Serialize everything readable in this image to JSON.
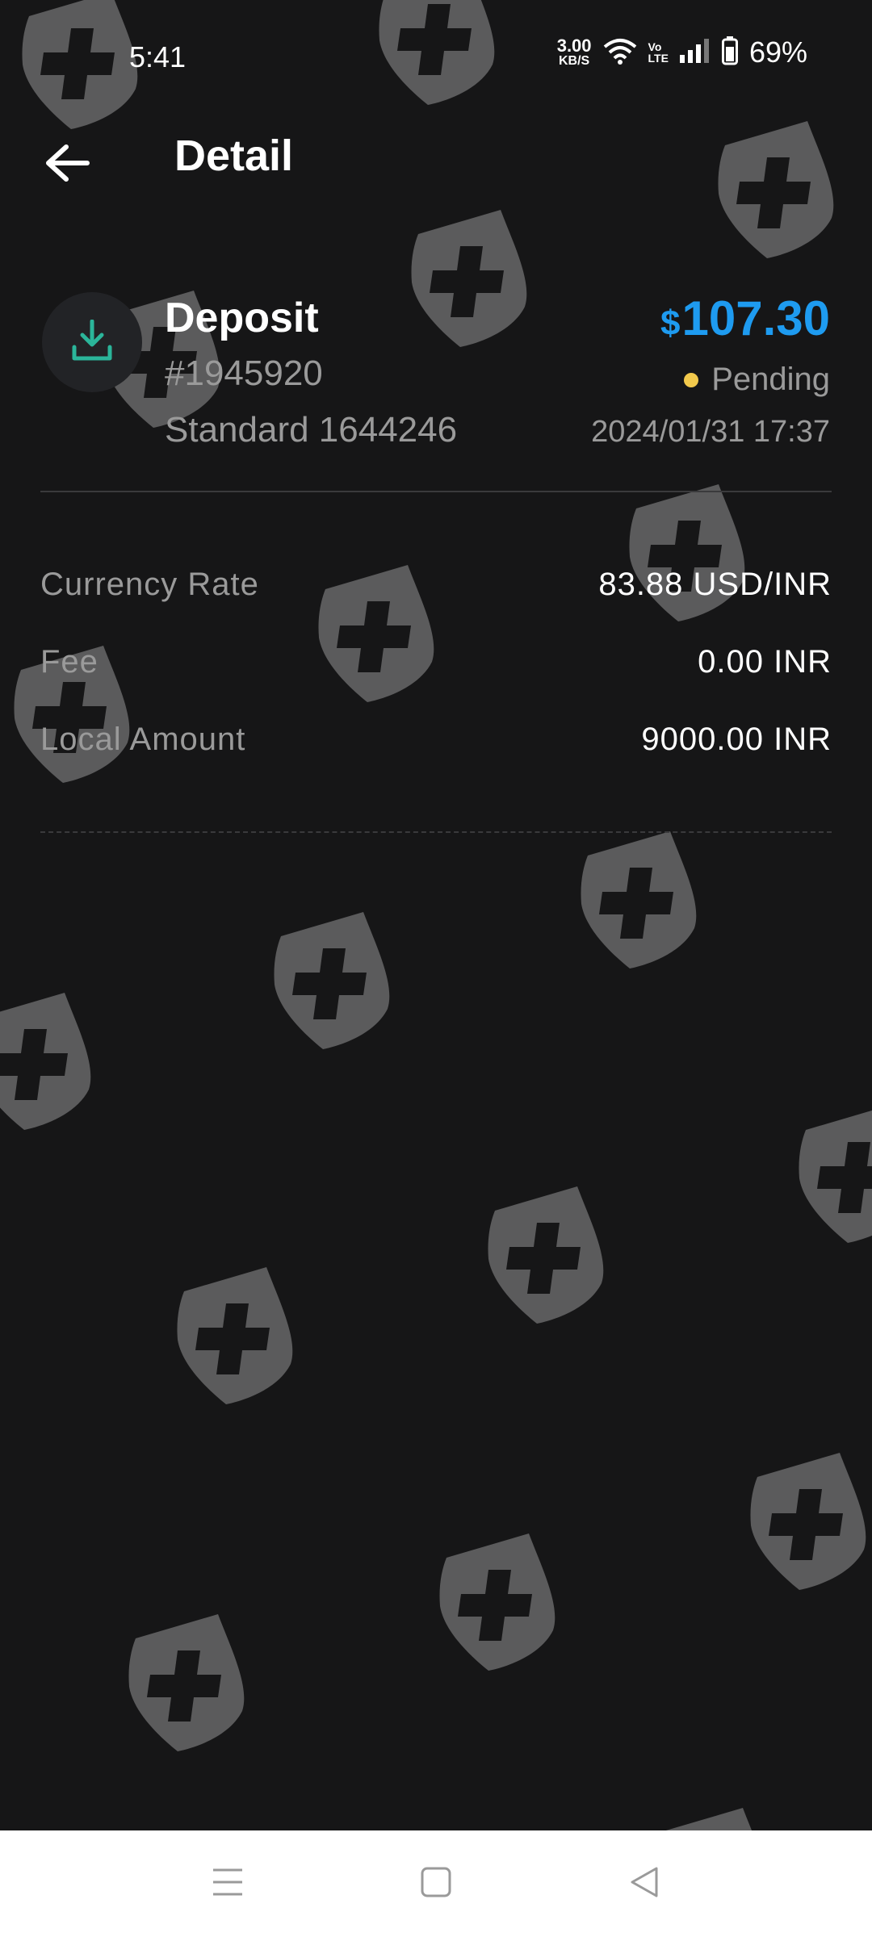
{
  "status_bar": {
    "time": "5:41",
    "net_speed_value": "3.00",
    "net_speed_unit": "KB/S",
    "volte_top": "Vo",
    "volte_bottom": "LTE",
    "battery_percent": "69%",
    "icons": [
      "wifi-icon",
      "signal-icon",
      "battery-icon"
    ]
  },
  "header": {
    "title": "Detail",
    "back_icon": "arrow-left-icon"
  },
  "transaction": {
    "icon": "download-icon",
    "type": "Deposit",
    "id": "#1945920",
    "account": "Standard 1644246",
    "currency_symbol": "$",
    "amount": "107.30",
    "status": "Pending",
    "datetime": "2024/01/31 17:37",
    "colors": {
      "amount": "#1e9bf0",
      "status_dot": "#f2c94c",
      "icon": "#2bb59a"
    }
  },
  "details": [
    {
      "label": "Currency Rate",
      "value": "83.88 USD/INR"
    },
    {
      "label": "Fee",
      "value": "0.00 INR"
    },
    {
      "label": "Local Amount",
      "value": "9000.00 INR"
    }
  ],
  "watermark_icon": "shield-plus-icon",
  "nav_bar": {
    "icons": [
      "menu-icon",
      "home-square-icon",
      "back-triangle-icon"
    ]
  }
}
